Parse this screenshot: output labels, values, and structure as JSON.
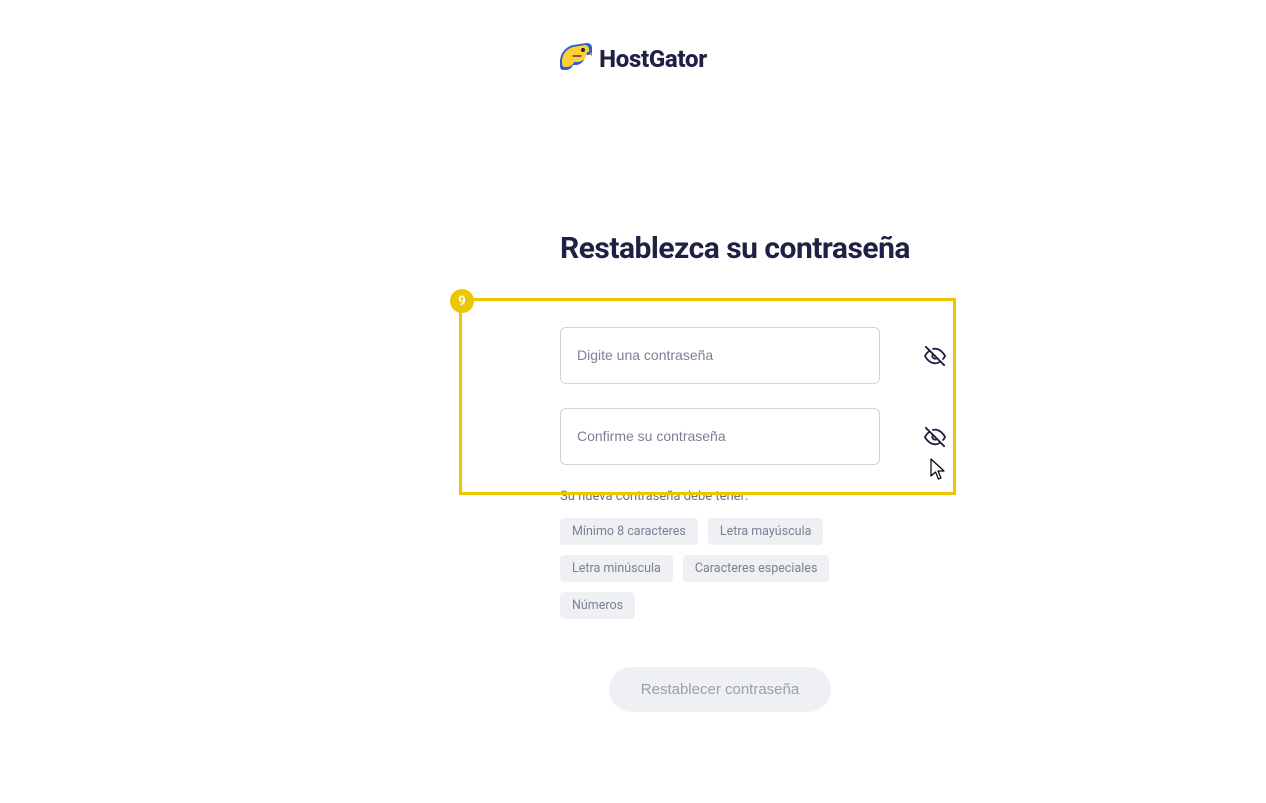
{
  "logo": {
    "brand_text": "HostGator"
  },
  "main": {
    "title": "Restablezca su contraseña",
    "highlight_number": "9",
    "password_input": {
      "placeholder": "Digite una contraseña",
      "value": ""
    },
    "confirm_input": {
      "placeholder": "Confirme su contraseña",
      "value": ""
    },
    "requirements_label": "Su nueva contraseña debe tener:",
    "requirements": [
      "Mínimo 8 caracteres",
      "Letra mayúscula",
      "Letra minúscula",
      "Caracteres especiales",
      "Números"
    ],
    "submit_label": "Restablecer contraseña"
  }
}
